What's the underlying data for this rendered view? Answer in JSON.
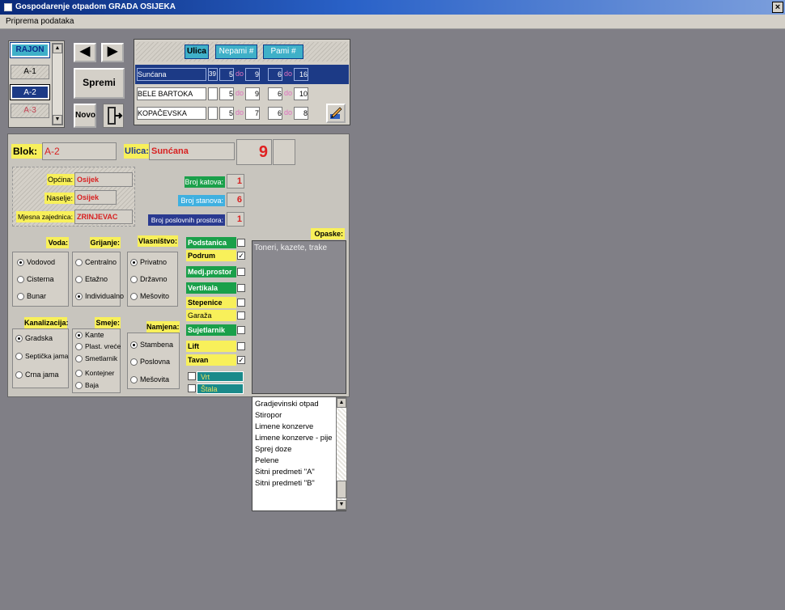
{
  "window": {
    "title": "Gospodarenje otpadom GRADA OSIJEKA",
    "close_label": "×"
  },
  "menu": {
    "item1": "Priprema podataka"
  },
  "rajon": {
    "header": "RAJON",
    "items": [
      "A-1",
      "A-2",
      "A-3"
    ],
    "selected": "A-2"
  },
  "nav": {
    "prev": "◀",
    "next": "▶",
    "save": "Spremi",
    "new": "Novo"
  },
  "streets": {
    "col_ulica": "Ulica",
    "col_nep": "Nepami  #",
    "col_par": "Pami   #",
    "rows": [
      {
        "name": "Sunćana",
        "num": "39",
        "nep_from": "5",
        "do": "do",
        "nep_to": "9",
        "par_from": "6",
        "do2": "do",
        "par_to": "16"
      },
      {
        "name": "BELE BARTOKA",
        "num": "",
        "nep_from": "5",
        "do": "do",
        "nep_to": "9",
        "par_from": "6",
        "do2": "do",
        "par_to": "10"
      },
      {
        "name": "KOPAČEVSKA",
        "num": "",
        "nep_from": "5",
        "do": "do",
        "nep_to": "7",
        "par_from": "6",
        "do2": "do",
        "par_to": "8"
      }
    ]
  },
  "block": {
    "blok_label": "Blok:",
    "blok_value": "A-2",
    "ulica_label": "Ulica:",
    "ulica_value": "Sunćana",
    "number_value": "9",
    "opcina_label": "Općina:",
    "opcina_value": "Osijek",
    "naselje_label": "Naselje:",
    "naselje_value": "Osijek",
    "mz_label": "Mjesna zajednica:",
    "mz_value": "ZRINJEVAC",
    "katova_label": "Broj katova:",
    "katova_value": "1",
    "stanova_label": "Broj stanova:",
    "stanova_value": "6",
    "posl_label": "Broj poslovnih prostora:",
    "posl_value": "1"
  },
  "voda": {
    "label": "Voda:",
    "options": [
      "Vodovod",
      "Cisterna",
      "Bunar"
    ],
    "selected": 0
  },
  "grijanje": {
    "label": "Grijanje:",
    "options": [
      "Centralno",
      "Etažno",
      "Individualno"
    ],
    "selected": 2
  },
  "vlasnistvo": {
    "label": "Vlasništvo:",
    "options": [
      "Privatno",
      "Državno",
      "Mešovito"
    ],
    "selected": 0
  },
  "kanalizacija": {
    "label": "Kanalizacija:",
    "options": [
      "Gradska",
      "Septička jama",
      "Crna jama"
    ],
    "selected": 0
  },
  "smece": {
    "label": "Smeje:",
    "options": [
      "Kante",
      "Plast. vreće",
      "Smetlarnik",
      "Kontejner",
      "Baja"
    ],
    "selected": 0
  },
  "namjena": {
    "label": "Namjena:",
    "options": [
      "Stambena",
      "Poslovna",
      "Mešovita"
    ],
    "selected": 0
  },
  "features": [
    {
      "label": "Podstanica",
      "checked": false,
      "color": "#1aa04a"
    },
    {
      "label": "Podrum",
      "checked": true,
      "color": "#f8f05a"
    },
    {
      "label": "Medj.prostor",
      "checked": false,
      "color": "#1aa04a"
    },
    {
      "label": "Vertikala",
      "checked": false,
      "color": "#1aa04a"
    },
    {
      "label": "Stepenice",
      "checked": false,
      "color": "#f8f05a"
    },
    {
      "label": "Garaža",
      "checked": false,
      "color": "#f8f05a"
    },
    {
      "label": "Sujetlarnik",
      "checked": false,
      "color": "#1aa04a"
    },
    {
      "label": "Lift",
      "checked": false,
      "color": "#f8f05a"
    },
    {
      "label": "Tavan",
      "checked": true,
      "color": "#f8f05a"
    }
  ],
  "extra": [
    {
      "label": "Vrt",
      "checked": false
    },
    {
      "label": "Štala",
      "checked": false
    }
  ],
  "opaske": {
    "label": "Opaske:",
    "text": "Toneri, kazete, trake"
  },
  "waste_list": [
    "Gradjevinski otpad",
    "Stiropor",
    "Limene konzerve",
    "Limene konzerve - pije",
    "Sprej doze",
    "Pelene",
    "Sitni predmeti \"A\"",
    "Sitni predmeti \"B\""
  ],
  "colors": {
    "selected_row": "#1c3a86",
    "header": "#3fb0c8",
    "accent_red": "#d82020",
    "green": "#1aa04a",
    "yellow": "#f8f05a"
  }
}
